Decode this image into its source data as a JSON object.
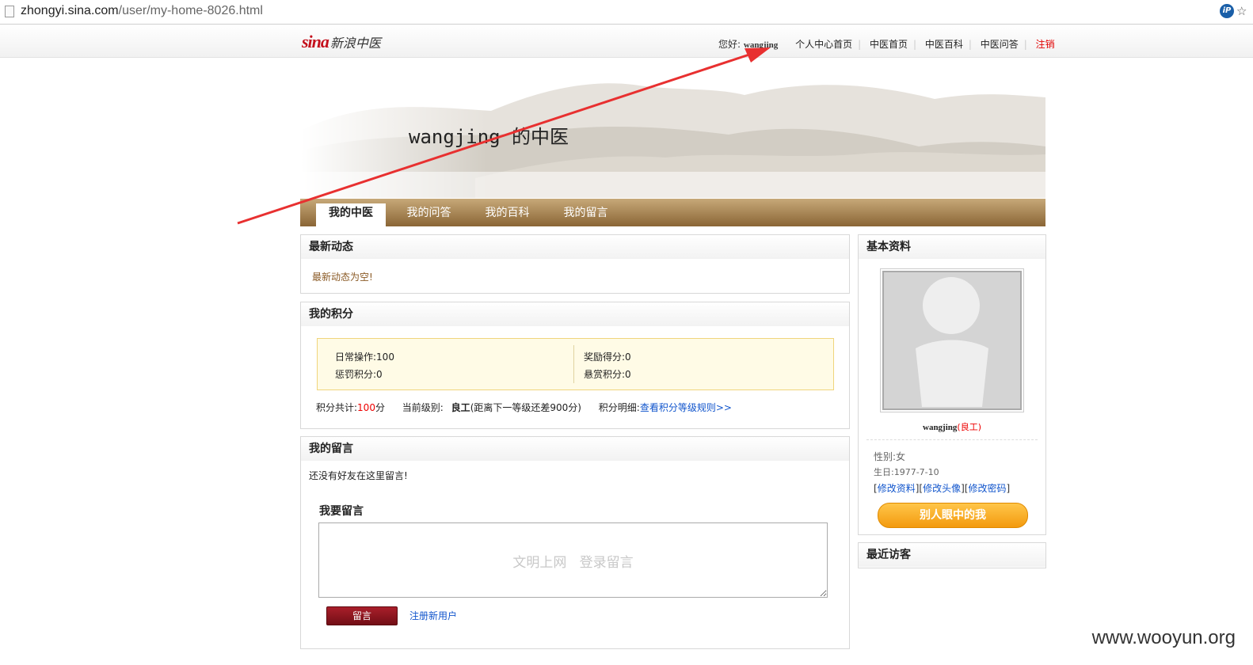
{
  "browser": {
    "url_host": "zhongyi.sina.com",
    "url_path": "/user/my-home-8026.html"
  },
  "header": {
    "logo_sina": "sina",
    "logo_title": "新浪中医",
    "greeting": "您好:",
    "username": "wangjing",
    "nav": [
      "个人中心首页",
      "中医首页",
      "中医百科",
      "中医问答"
    ],
    "logout": "注销"
  },
  "banner": {
    "title": "wangjing 的中医"
  },
  "tabs": [
    "我的中医",
    "我的问答",
    "我的百科",
    "我的留言"
  ],
  "news": {
    "title": "最新动态",
    "empty": "最新动态为空!"
  },
  "score": {
    "title": "我的积分",
    "daily": "日常操作:100",
    "reward": "奖励得分:0",
    "penalty": "惩罚积分:0",
    "bounty": "悬赏积分:0",
    "total_label": "积分共计:",
    "total_value": "100",
    "total_unit": "分",
    "level_label": "当前级别:",
    "level_value": "良工",
    "level_note": "(距离下一等级还差900分)",
    "detail_label": "积分明细:",
    "detail_link": "查看积分等级规则>>"
  },
  "messages": {
    "title": "我的留言",
    "none": "还没有好友在这里留言!",
    "compose_title": "我要留言",
    "placeholder": "文明上网   登录留言",
    "submit": "留言",
    "register": "注册新用户"
  },
  "profile": {
    "title": "基本资料",
    "name": "wangjing",
    "level": "(良工)",
    "gender": "性别:女",
    "birthday": "生日:1977-7-10",
    "edit_info": "修改资料",
    "edit_avatar": "修改头像",
    "edit_password": "修改密码",
    "others_view": "别人眼中的我"
  },
  "visitors": {
    "title": "最近访客"
  },
  "watermark": "www.wooyun.org",
  "colors": {
    "accent_red": "#e10000",
    "tab_brown": "#8a6535",
    "link_blue": "#1155cc",
    "button_orange": "#f39a0e",
    "arrow_red": "#e83030"
  }
}
